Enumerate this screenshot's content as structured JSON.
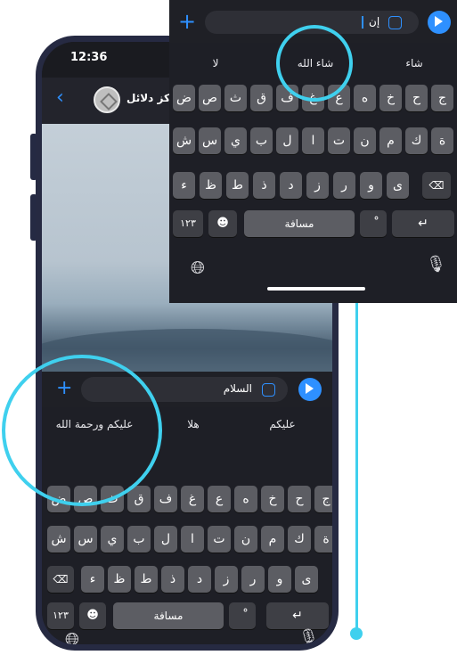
{
  "status": {
    "time": "12:36"
  },
  "chat": {
    "contact_name": "مركز دلائل"
  },
  "composer": {
    "text": "السلام"
  },
  "keyboard": {
    "suggestions": [
      "عليكم ورحمة الله",
      "هلا",
      "عليكم"
    ],
    "row1": [
      "ض",
      "ص",
      "ث",
      "ق",
      "ف",
      "غ",
      "ع",
      "ه",
      "خ",
      "ح",
      "ج"
    ],
    "row2": [
      "ش",
      "س",
      "ي",
      "ب",
      "ل",
      "ا",
      "ت",
      "ن",
      "م",
      "ك",
      "ة"
    ],
    "row3": [
      "ء",
      "ظ",
      "ط",
      "ذ",
      "د",
      "ز",
      "ر",
      "و",
      "ى"
    ],
    "numbers_key": "١٢٣",
    "space_key": "مسافة",
    "diacritic_key": "ْ",
    "return_key": "↵"
  },
  "zoom": {
    "composer_text": "إن",
    "suggestions": [
      "لا",
      "شاء الله",
      "شاء"
    ],
    "row1": [
      "ض",
      "ص",
      "ث",
      "ق",
      "ف",
      "غ",
      "ع",
      "ه",
      "خ",
      "ح",
      "ج"
    ],
    "row2": [
      "ش",
      "س",
      "ي",
      "ب",
      "ل",
      "ا",
      "ت",
      "ن",
      "م",
      "ك",
      "ة"
    ],
    "row3": [
      "ء",
      "ظ",
      "ط",
      "ذ",
      "د",
      "ز",
      "ر",
      "و",
      "ى"
    ],
    "numbers_key": "١٢٣",
    "space_key": "مسافة",
    "diacritic_key": "ْ",
    "return_key": "↵"
  },
  "icons": {
    "globe": "globe-icon",
    "mic": "microphone-icon",
    "emoji": "emoji-icon",
    "delete": "delete-icon",
    "plus": "plus-icon",
    "send": "send-icon",
    "back": "back-chevron-icon",
    "sticker": "sticker-icon"
  },
  "colors": {
    "accent": "#2e90ff",
    "highlight": "#3fd0ee",
    "frame": "#262a42"
  }
}
